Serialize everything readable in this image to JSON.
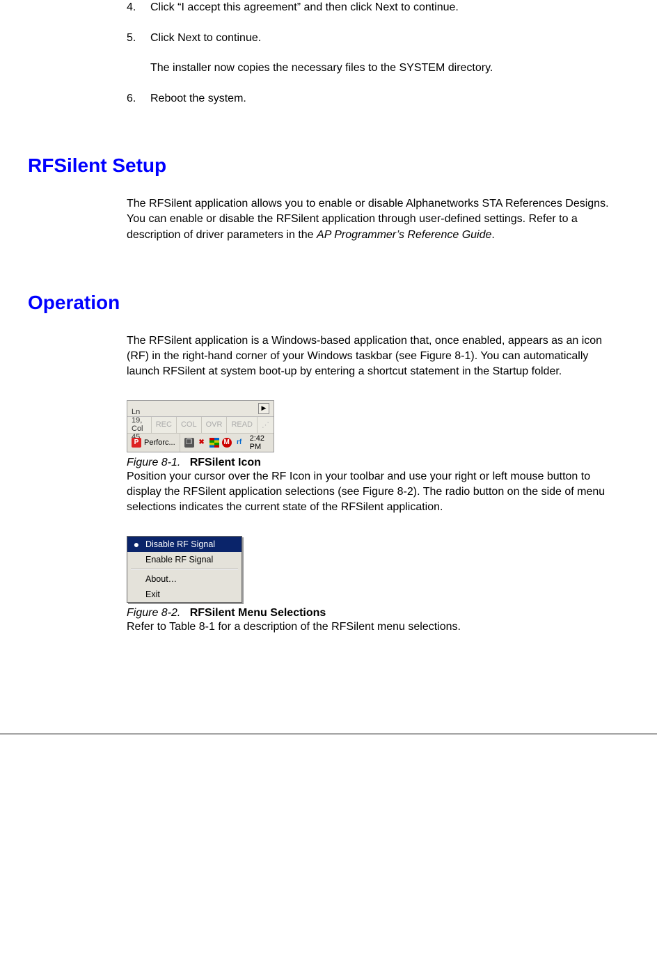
{
  "steps": {
    "s4": {
      "num": "4.",
      "text": "Click “I accept this agreement” and then click Next to continue."
    },
    "s5": {
      "num": "5.",
      "text": "Click Next to continue."
    },
    "s5_extra": "The installer now copies the necessary files to the SYSTEM directory.",
    "s6": {
      "num": "6.",
      "text": "Reboot the system."
    }
  },
  "section1": {
    "heading": "RFSilent Setup",
    "para_before_italic": "The RFSilent application allows you to enable or disable Alphanetworks STA References Designs. You can enable or disable the RFSilent application through user-defined settings. Refer to a description of driver parameters in the ",
    "para_italic": "AP Programmer’s Reference Guide",
    "para_after_italic": "."
  },
  "section2": {
    "heading": "Operation",
    "para1": "The RFSilent application is a Windows-based application that, once enabled, appears as an icon (RF) in the right-hand corner of your Windows taskbar (see Figure 8-1). You can automatically launch RFSilent at system boot-up by entering a shortcut statement in the Startup folder.",
    "para2": "Position your cursor over the RF Icon in your toolbar and use your right or left mouse button to display the RFSilent application selections (see Figure 8-2). The radio button on the side of menu selections indicates the current state of the RFSilent application.",
    "para3": "Refer to Table 8-1 for a description of the RFSilent menu selections."
  },
  "fig1": {
    "caption_label": "Figure 8-1.",
    "caption_title": "RFSilent Icon",
    "status_pos": "Ln 19, Col 45",
    "st_rec": "REC",
    "st_col": "COL",
    "st_ovr": "OVR",
    "st_read": "READ",
    "task_label": "Perforc...",
    "rf_glyph": "rf",
    "m_glyph": "M",
    "time": "2:42 PM"
  },
  "fig2": {
    "caption_label": "Figure 8-2.",
    "caption_title": "RFSilent Menu Selections",
    "items": {
      "disable": "Disable RF Signal",
      "enable": "Enable RF Signal",
      "about": "About…",
      "exit": "Exit"
    }
  }
}
